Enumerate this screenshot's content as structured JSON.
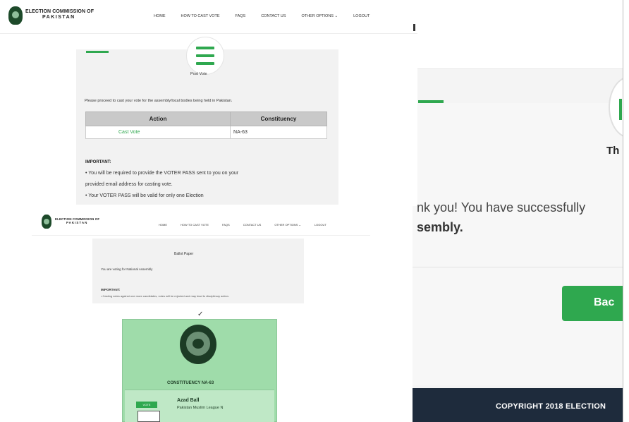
{
  "org": {
    "name_line1": "ELECTION COMMISSION OF",
    "name_line2": "PAKISTAN"
  },
  "nav": {
    "items": [
      "HOME",
      "HOW TO CAST VOTE",
      "FAQS",
      "CONTACT US",
      "OTHER OPTIONS ⌄",
      "LOGOUT"
    ]
  },
  "cast_page": {
    "title": "Post Vote",
    "intro": "Please proceed to cast your vote for the assembly/local bodies being held in Pakistan.",
    "table": {
      "headers": [
        "Action",
        "Constituency"
      ],
      "rows": [
        {
          "action": "Cast Vote",
          "constituency": "NA-63"
        }
      ]
    },
    "important_label": "IMPORTANT:",
    "bullets": [
      "• You will be required to provide the VOTER PASS sent to you on your",
      "  provided email address for casting vote.",
      "• Your VOTER PASS will be valid for only one Election"
    ]
  },
  "ballot_page": {
    "title": "Ballot Paper",
    "line": "You are voting for National Assembly",
    "important_label": "IMPORTANT:",
    "note": "• Casting votes against one more candidates, votes will be rejected and may lead to disciplinary action."
  },
  "ballot": {
    "check": "✓",
    "constituency": "CONSTITUENCY NA-63",
    "vote_label": "VOTE",
    "candidate_name": "Azad Ball",
    "candidate_party": "Pakistan Muslim League N"
  },
  "thanks_page": {
    "heading_fragment": "Th",
    "message_line1": "nk you! You have successfully",
    "message_line2": "sembly.",
    "back_label": "Bac",
    "footer": "COPYRIGHT 2018 ELECTION"
  },
  "colors": {
    "accent_green": "#2fa84f",
    "ballot_green": "#9fdcaa",
    "footer_navy": "#1e2b3c"
  },
  "icons": [
    "logo-emblem",
    "hamburger-menu-icon",
    "check-icon",
    "state-emblem"
  ]
}
